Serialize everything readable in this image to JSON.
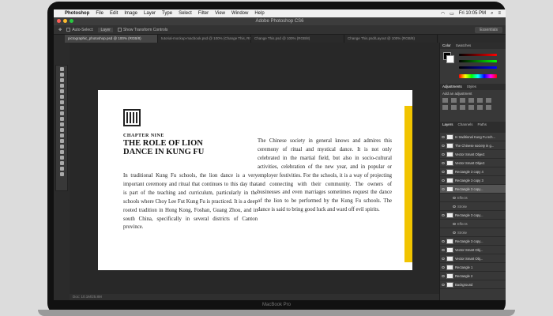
{
  "mac_menubar": {
    "app": "Photoshop",
    "items": [
      "File",
      "Edit",
      "Image",
      "Layer",
      "Type",
      "Select",
      "Filter",
      "View",
      "Window",
      "Help"
    ],
    "clock": "Fri 10:05 PM"
  },
  "titlebar": {
    "title": "Adobe Photoshop CS6"
  },
  "options_bar": {
    "auto_select_label": "Auto-Select:",
    "auto_select_value": "Layer",
    "show_transform_label": "Show Transform Controls",
    "workspace": "Essentials"
  },
  "doc_tabs": [
    "pictographic_photoshop.psd @ 100% (RGB/8)",
    "tutorial-mockup-macbook.psd @ 100% (Change This, RGB/8)",
    "Change This.psd @ 100% (RGB/8)",
    "Change This.psd/Layout @ 100% (RGB/8)"
  ],
  "document": {
    "chapter": "CHAPTER NINE",
    "heading_line1": "THE ROLE OF LION",
    "heading_line2": "DANCE IN KUNG FU",
    "body_left": "In traditional Kung Fu schools, the lion dance is a very important ceremony and ritual that continues to this day that is part of the teaching and curriculum, particularly in the schools where Choy Lee Fut Kung Fu is practiced. It is a deep rooted tradition in Hong Kong, Foshan, Guang Zhou, and in south China, specifically in several districts of Canton province.",
    "body_right": "The Chinese society in general knows and admires this ceremony of ritual and mystical dance. It is not only celebrated in the martial field, but also in socio-cultural activities, celebration of the new year, and in popular or employer festivities. For the schools, it is a way of projecting and connecting with their community. The owners of businesses and even marriages sometimes request the dance of the lion to be performed by the Kung Fu schools. The dance is said to bring good luck and ward off evil spirits."
  },
  "statusbar": {
    "text": "Doc: 10.1M/25.8M"
  },
  "panels": {
    "color_tabs": [
      "Color",
      "Swatches"
    ],
    "adjustments_tabs": [
      "Adjustments",
      "Styles"
    ],
    "adjustments_title": "Add an adjustment",
    "layers_tabs": [
      "Layers",
      "Channels",
      "Paths"
    ],
    "layers": [
      {
        "name": "In traditional Kung Fu sch...",
        "sub": false,
        "selected": false
      },
      {
        "name": "The Chinese society in g...",
        "sub": false,
        "selected": false
      },
      {
        "name": "Vector Smart Object",
        "sub": false,
        "selected": false
      },
      {
        "name": "Vector Smart Object",
        "sub": false,
        "selected": false
      },
      {
        "name": "Rectangle 3 copy 4",
        "sub": false,
        "selected": false
      },
      {
        "name": "Rectangle 3 copy 3",
        "sub": false,
        "selected": false
      },
      {
        "name": "Rectangle 3 copy...",
        "sub": false,
        "selected": true
      },
      {
        "name": "Effects",
        "sub": true,
        "selected": false
      },
      {
        "name": "Stroke",
        "sub": true,
        "selected": false
      },
      {
        "name": "Rectangle 3 copy...",
        "sub": false,
        "selected": false
      },
      {
        "name": "Effects",
        "sub": true,
        "selected": false
      },
      {
        "name": "Stroke",
        "sub": true,
        "selected": false
      },
      {
        "name": "Rectangle 3 copy...",
        "sub": false,
        "selected": false
      },
      {
        "name": "Vector Smart Obj...",
        "sub": false,
        "selected": false
      },
      {
        "name": "Vector Smart Obj...",
        "sub": false,
        "selected": false
      },
      {
        "name": "Rectangle 1",
        "sub": false,
        "selected": false
      },
      {
        "name": "Rectangle 2",
        "sub": false,
        "selected": false
      },
      {
        "name": "Background",
        "sub": false,
        "selected": false
      }
    ]
  },
  "device_label": "MacBook Pro",
  "colors": {
    "accent_bar": "#f1c400",
    "ps_dark": "#2b2b2b"
  }
}
